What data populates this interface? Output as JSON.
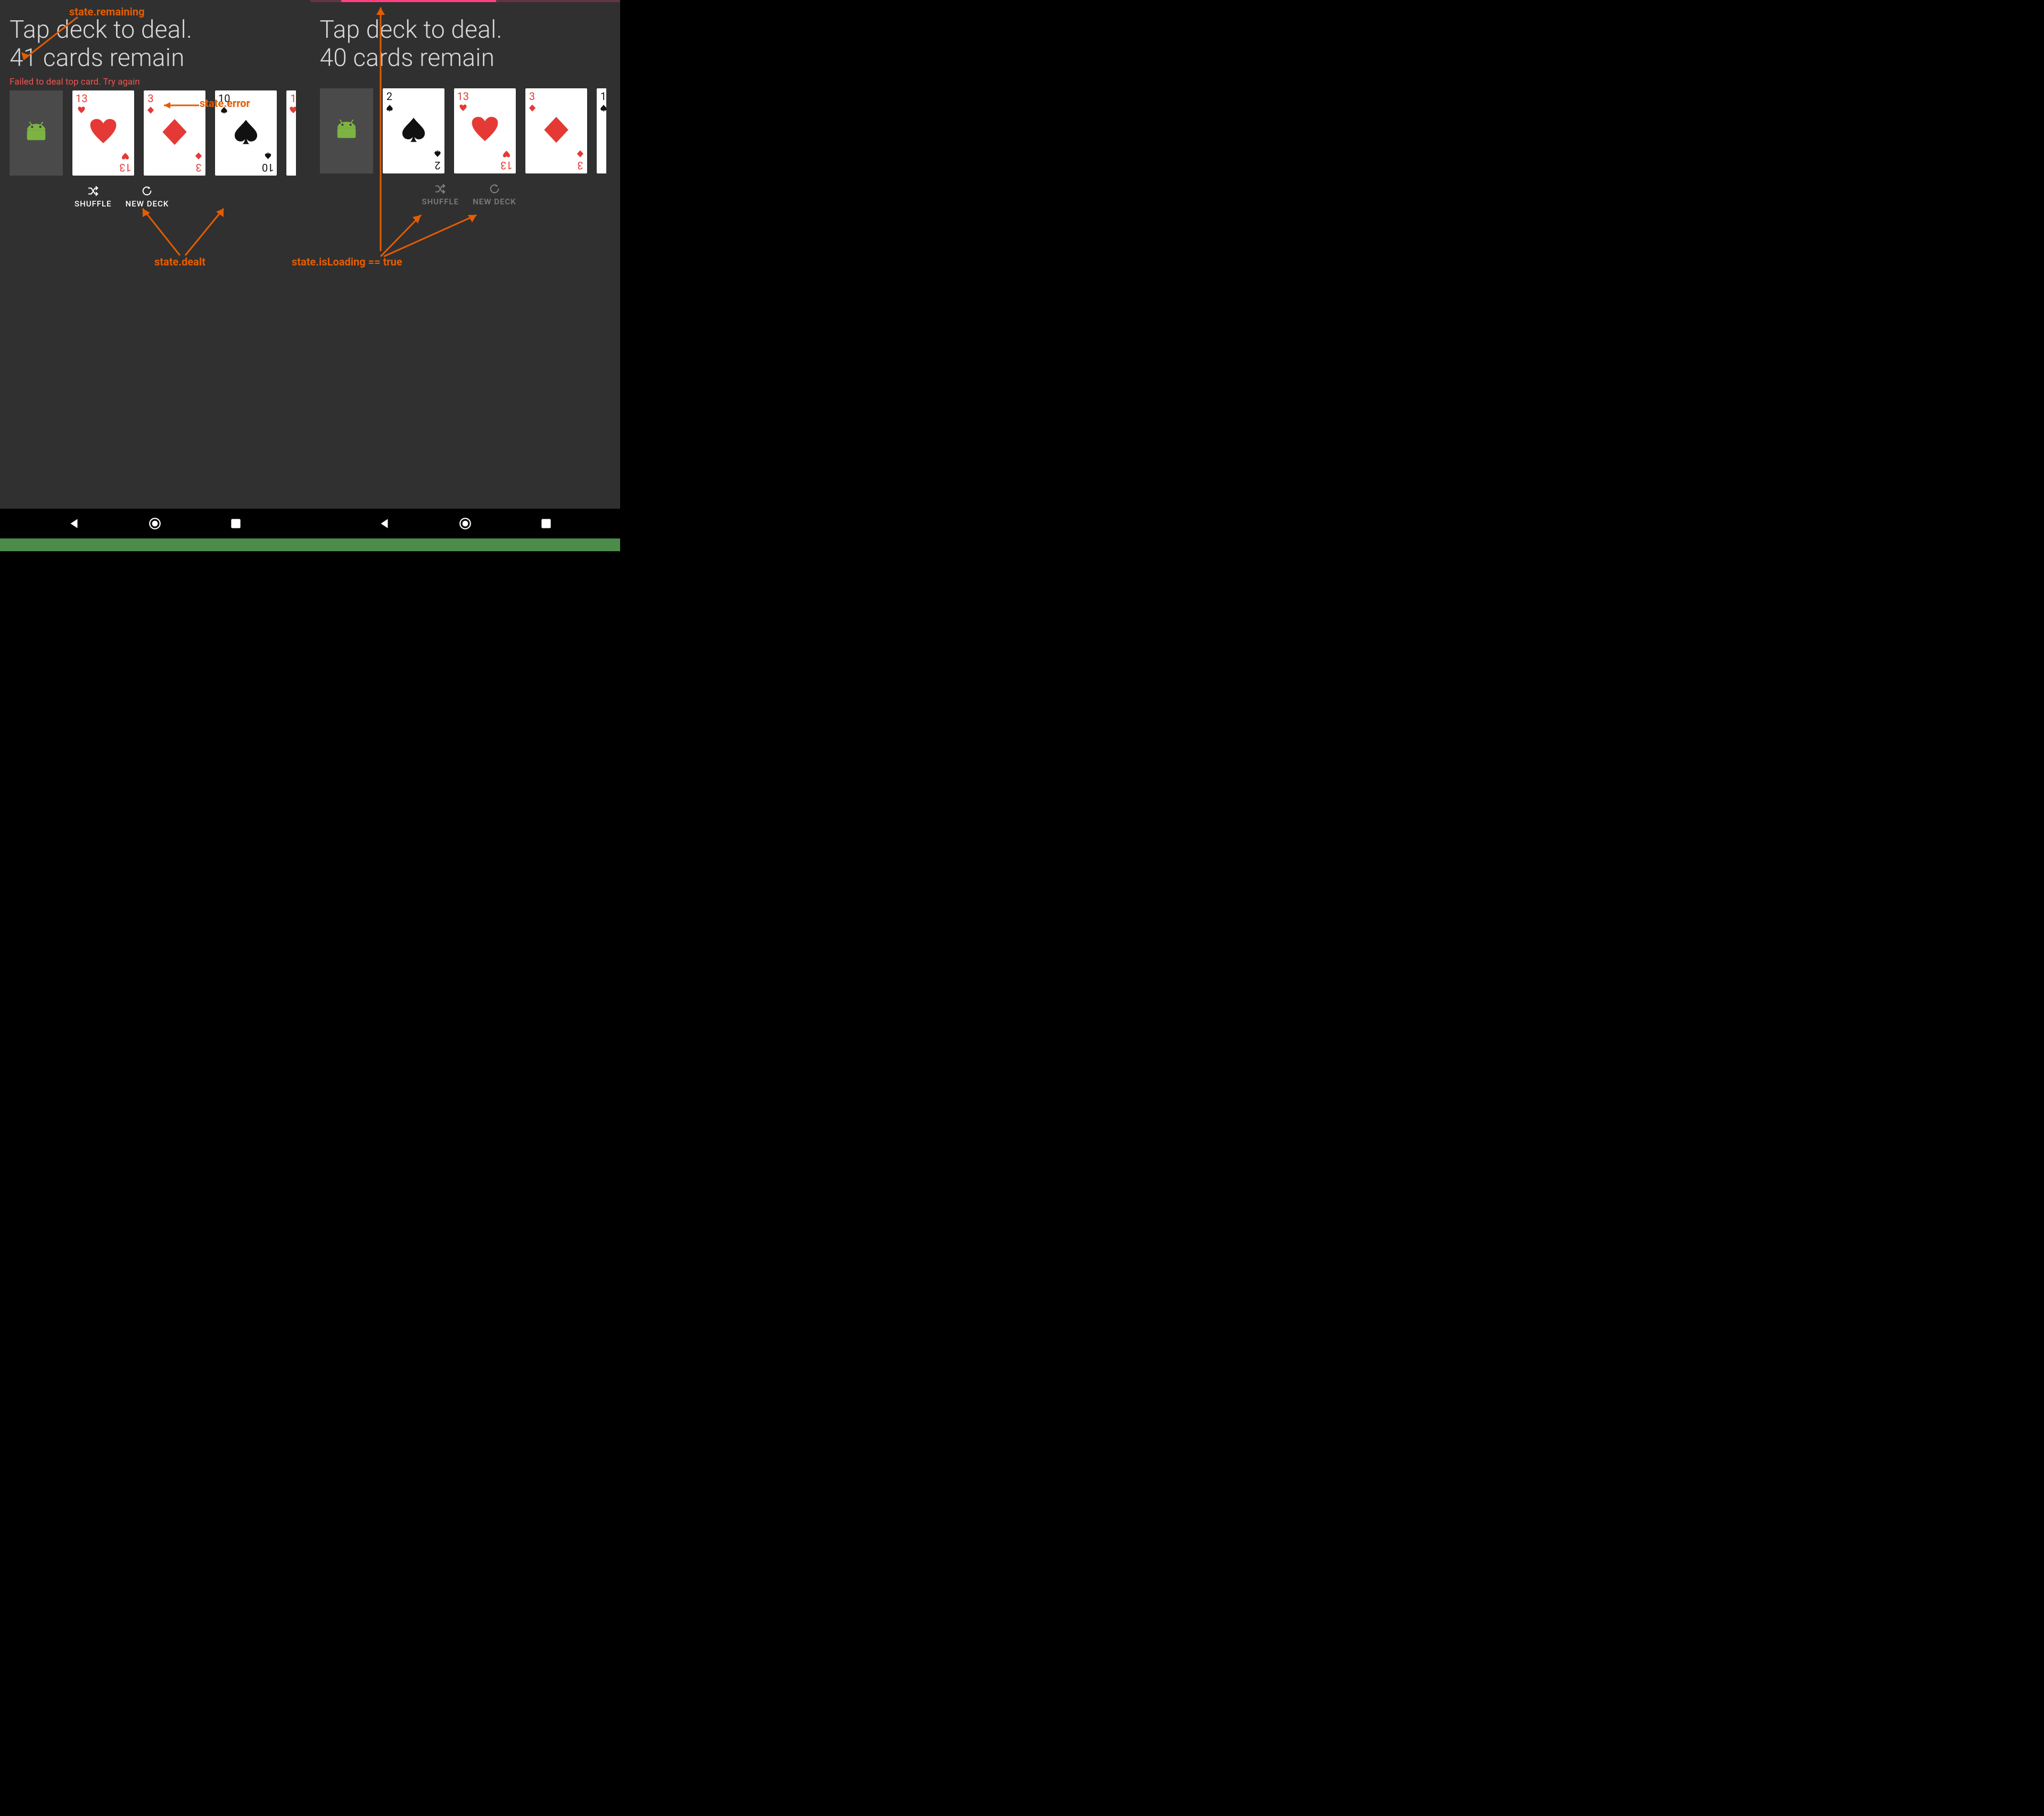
{
  "annotations": {
    "remaining": "state.remaining",
    "error": "state.error",
    "dealt": "state.dealt",
    "loading": "state.isLoading == true"
  },
  "left": {
    "title_line1": "Tap deck to deal.",
    "title_line2": "41 cards remain",
    "error": "Failed to deal top card. Try again",
    "cards": [
      {
        "rank": "13",
        "suit": "heart",
        "color": "red"
      },
      {
        "rank": "3",
        "suit": "diamond",
        "color": "red"
      },
      {
        "rank": "10",
        "suit": "spade",
        "color": "black"
      }
    ],
    "peek": {
      "rank": "1",
      "suit": "heart",
      "color": "red"
    },
    "actions": {
      "shuffle": "SHUFFLE",
      "newdeck": "NEW DECK"
    }
  },
  "right": {
    "title_line1": "Tap deck to deal.",
    "title_line2": "40 cards remain",
    "cards": [
      {
        "rank": "2",
        "suit": "spade",
        "color": "black"
      },
      {
        "rank": "13",
        "suit": "heart",
        "color": "red"
      },
      {
        "rank": "3",
        "suit": "diamond",
        "color": "red"
      }
    ],
    "peek": {
      "rank": "1",
      "suit": "spade",
      "color": "black"
    },
    "actions": {
      "shuffle": "SHUFFLE",
      "newdeck": "NEW DECK"
    },
    "loading": true
  }
}
